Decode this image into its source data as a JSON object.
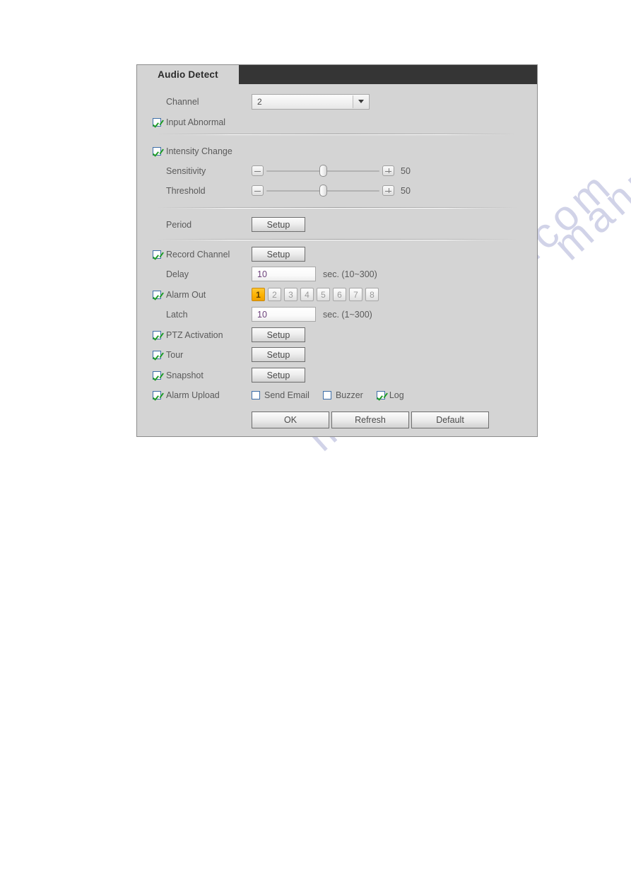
{
  "window": {
    "tab_label": "Audio Detect"
  },
  "form": {
    "channel": {
      "label": "Channel",
      "value": "2"
    },
    "input_abnormal": {
      "label": "Input Abnormal",
      "checked": true
    },
    "intensity_change": {
      "label": "Intensity Change",
      "checked": true
    },
    "sensitivity": {
      "label": "Sensitivity",
      "value": "50",
      "minus_label": "decrease",
      "plus_label": "increase"
    },
    "threshold": {
      "label": "Threshold",
      "value": "50"
    },
    "period": {
      "label": "Period",
      "setup_label": "Setup"
    },
    "record_channel": {
      "label": "Record Channel",
      "checked": true,
      "setup_label": "Setup"
    },
    "delay": {
      "label": "Delay",
      "value": "10",
      "unit": "sec. (10~300)"
    },
    "alarm_out": {
      "label": "Alarm Out",
      "checked": true,
      "buttons": [
        "1",
        "2",
        "3",
        "4",
        "5",
        "6",
        "7",
        "8"
      ],
      "selected": "1"
    },
    "latch": {
      "label": "Latch",
      "value": "10",
      "unit": "sec. (1~300)"
    },
    "ptz_activation": {
      "label": "PTZ Activation",
      "checked": true,
      "setup_label": "Setup"
    },
    "tour": {
      "label": "Tour",
      "checked": true,
      "setup_label": "Setup"
    },
    "snapshot": {
      "label": "Snapshot",
      "checked": true,
      "setup_label": "Setup"
    },
    "alarm_upload": {
      "label": "Alarm Upload",
      "checked": true
    },
    "send_email": {
      "label": "Send Email",
      "checked": false
    },
    "buzzer": {
      "label": "Buzzer",
      "checked": false
    },
    "log": {
      "label": "Log",
      "checked": true
    }
  },
  "actions": {
    "ok": "OK",
    "refresh": "Refresh",
    "default": "Default"
  },
  "watermark": {
    "text_1": "manualshive.com",
    "text_2": "manualshive.com"
  },
  "colors": {
    "panel_bg": "#d4d4d4",
    "titlebar": "#353535",
    "accent_orange": "#fdb200",
    "check_green": "#1f9c28",
    "checkbox_border": "#3f6fa8",
    "input_text": "#6b3f7a",
    "label_text": "#5a5a5a"
  }
}
